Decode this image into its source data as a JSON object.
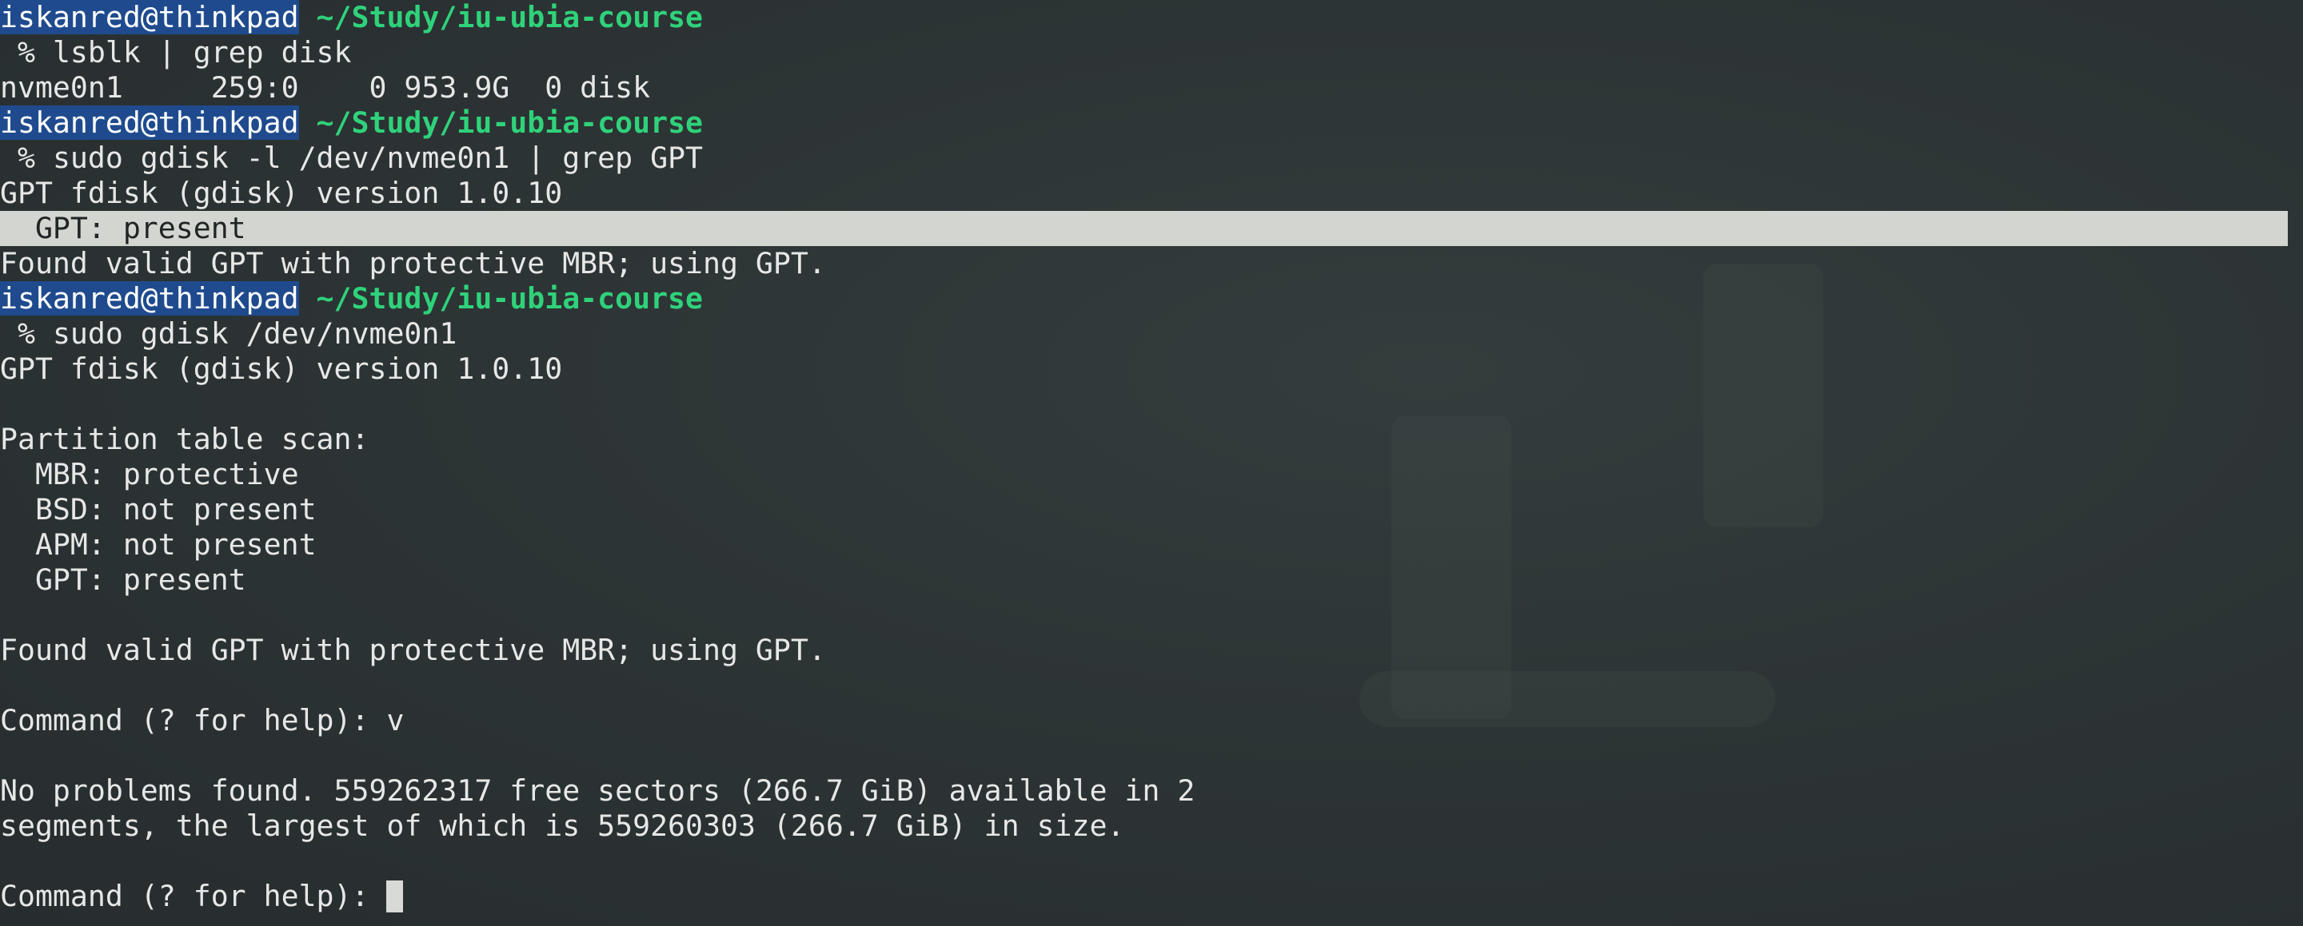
{
  "prompt": {
    "user": "iskanred@thinkpad",
    "path": " ~/Study/iu-ubia-course",
    "symbol": " % "
  },
  "commands": {
    "c1": "lsblk | grep disk",
    "c2": "sudo gdisk -l /dev/nvme0n1 | grep GPT",
    "c3": "sudo gdisk /dev/nvme0n1"
  },
  "output": {
    "lsblk": "nvme0n1     259:0    0 953.9G  0 disk",
    "version": "GPT fdisk (gdisk) version 1.0.10",
    "gpt_present": "  GPT: present",
    "found_valid": "Found valid GPT with protective MBR; using GPT.",
    "scan_title": "Partition table scan:",
    "mbr": "  MBR: protective",
    "bsd": "  BSD: not present",
    "apm": "  APM: not present",
    "gpt": "  GPT: present",
    "cmd_prompt_v": "Command (? for help): v",
    "no_problems_1": "No problems found. 559262317 free sectors (266.7 GiB) available in 2",
    "no_problems_2": "segments, the largest of which is 559260303 (266.7 GiB) in size.",
    "cmd_prompt_final": "Command (? for help): "
  },
  "colors": {
    "background": "#2b3233",
    "text": "#e6e8e6",
    "user_bg": "#1f4b8e",
    "path": "#2fd27a",
    "highlight_bg": "#d2d5d0"
  }
}
